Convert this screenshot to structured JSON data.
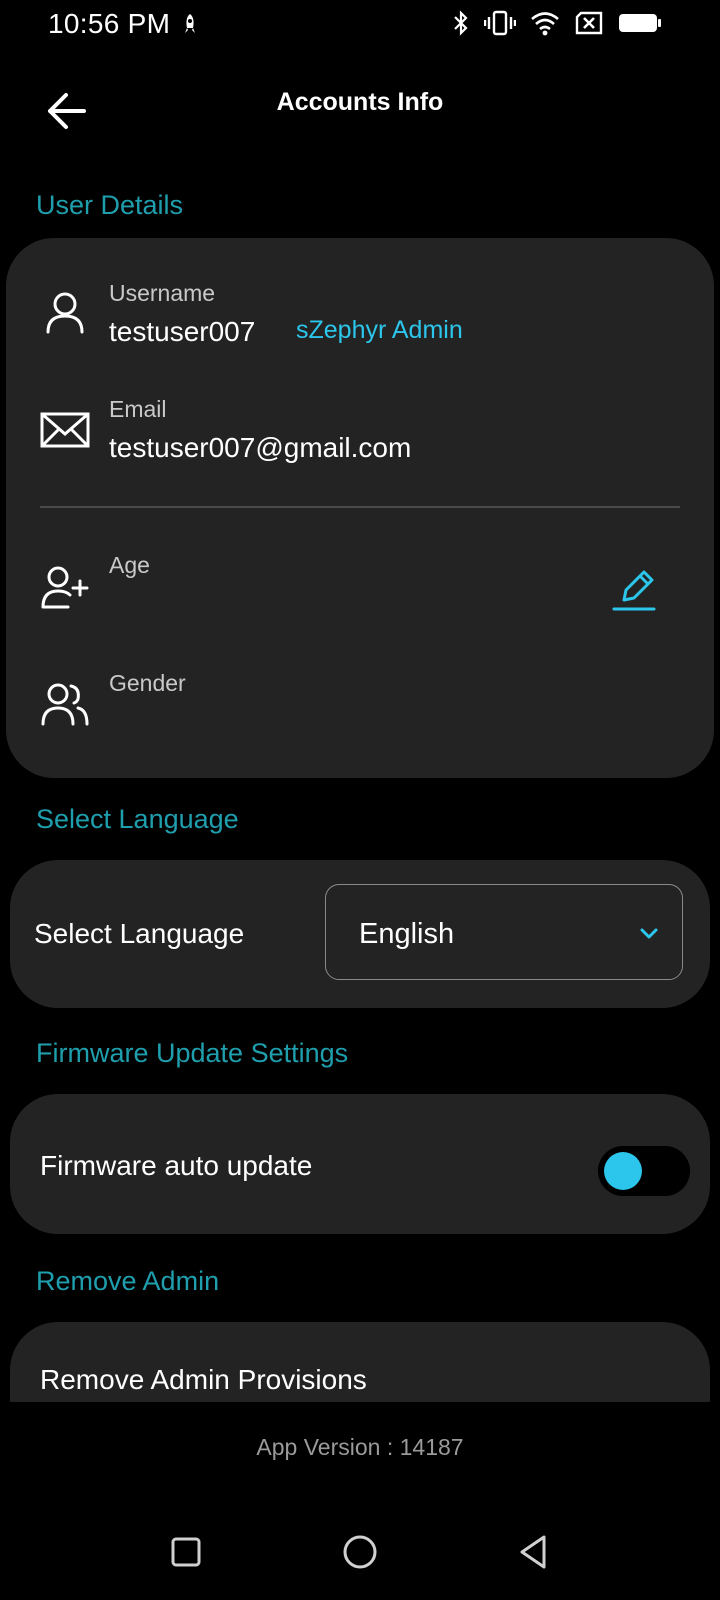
{
  "status_bar": {
    "time": "10:56 PM",
    "icons": [
      "notification-icon",
      "bluetooth-icon",
      "vibrate-icon",
      "wifi-icon",
      "no-sim-icon",
      "battery-icon"
    ]
  },
  "header": {
    "title": "Accounts Info",
    "back_icon": "arrow-left-icon"
  },
  "user_details": {
    "section_title": "User Details",
    "username_label": "Username",
    "username_value": "testuser007",
    "role_badge": "sZephyr Admin",
    "email_label": "Email",
    "email_value": "testuser007@gmail.com",
    "age_label": "Age",
    "gender_label": "Gender"
  },
  "language": {
    "section_title": "Select Language",
    "row_label": "Select Language",
    "selected": "English"
  },
  "firmware": {
    "section_title": "Firmware Update Settings",
    "row_label": "Firmware auto update",
    "auto_update_enabled": false
  },
  "remove_admin": {
    "section_title": "Remove Admin",
    "row_label": "Remove Admin Provisions"
  },
  "footer": {
    "version_text": "App Version : 14187"
  },
  "nav_bar": {
    "buttons": [
      "recents-icon",
      "home-icon",
      "back-triangle-icon"
    ]
  },
  "colors": {
    "accent": "#2cc6ec",
    "section": "#1f9fae",
    "card": "#232323",
    "background": "#000000"
  }
}
